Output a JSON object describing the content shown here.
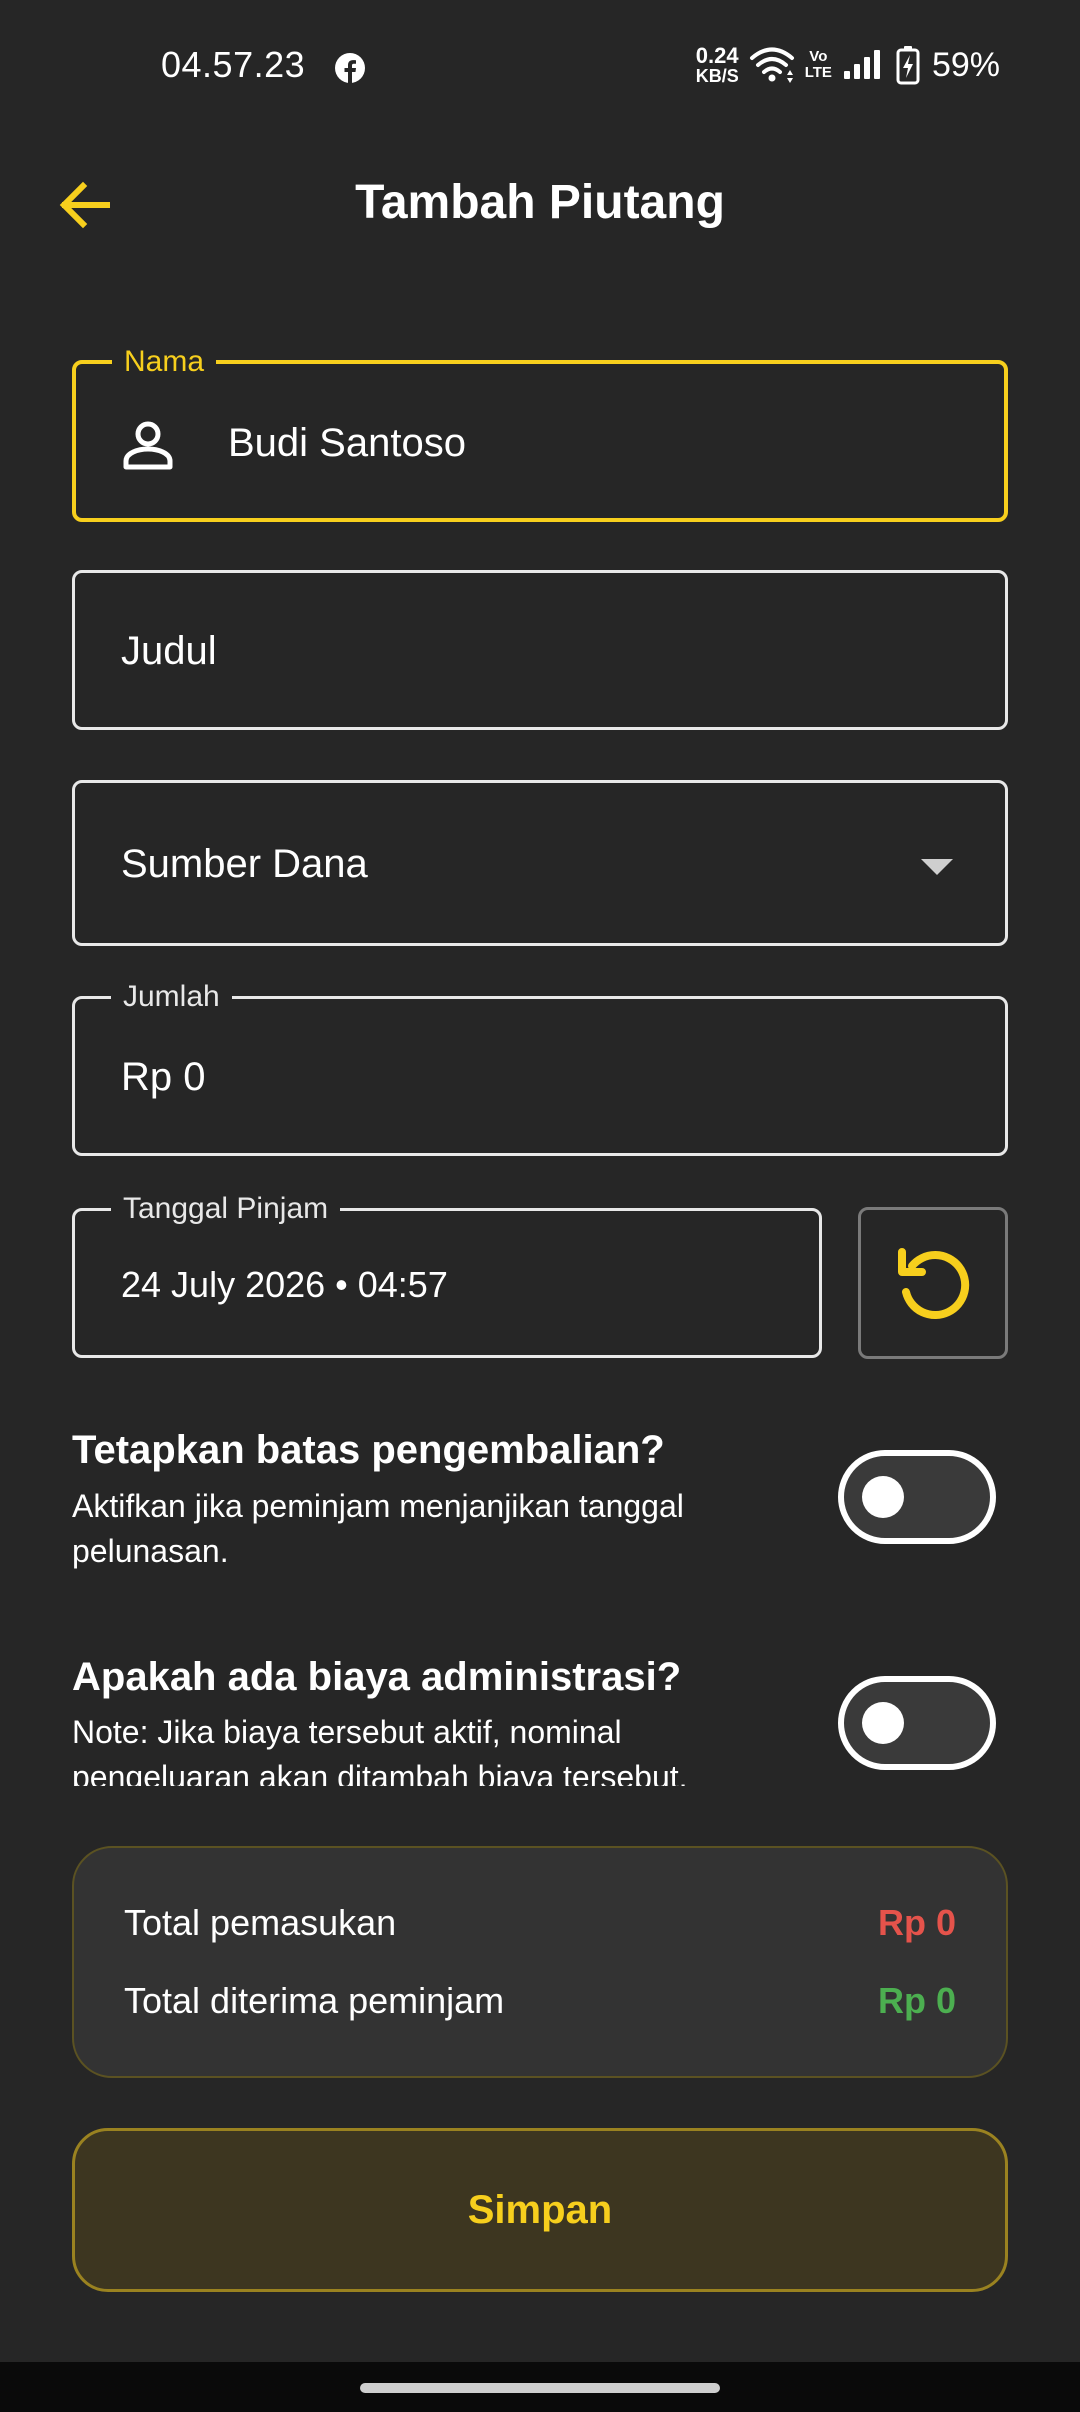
{
  "status_bar": {
    "time": "04.57.23",
    "net_speed_value": "0.24",
    "net_speed_unit": "KB/S",
    "volte_top": "Vo",
    "volte_bottom": "LTE",
    "battery": "59%",
    "icons": [
      "facebook-icon",
      "wifi-icon",
      "signal-icon",
      "battery-charging-icon"
    ]
  },
  "header": {
    "title": "Tambah Piutang",
    "back_icon": "arrow-left-icon"
  },
  "form": {
    "nama": {
      "label": "Nama",
      "value": "Budi Santoso",
      "icon": "person-icon"
    },
    "judul": {
      "placeholder": "Judul"
    },
    "sumber_dana": {
      "placeholder": "Sumber Dana"
    },
    "jumlah": {
      "label": "Jumlah",
      "value": "Rp 0"
    },
    "tanggal_pinjam": {
      "label": "Tanggal Pinjam",
      "value": "24 July 2026 • 04:57"
    },
    "reset_icon": "refresh-icon"
  },
  "toggles": {
    "batas": {
      "title": "Tetapkan batas pengembalian?",
      "desc": "Aktifkan jika peminjam menjanjikan tanggal pelunasan.",
      "on": false
    },
    "admin": {
      "title": "Apakah ada biaya administrasi?",
      "desc": "Note: Jika biaya tersebut aktif, nominal pengeluaran akan ditambah biaya tersebut.",
      "on": false
    }
  },
  "summary": {
    "pemasukan_label": "Total pemasukan",
    "pemasukan_value": "Rp 0",
    "diterima_label": "Total diterima peminjam",
    "diterima_value": "Rp 0"
  },
  "save_label": "Simpan",
  "colors": {
    "background": "#262626",
    "accent": "#f7cf1d",
    "negative": "#e5534b",
    "positive": "#4caf50"
  }
}
